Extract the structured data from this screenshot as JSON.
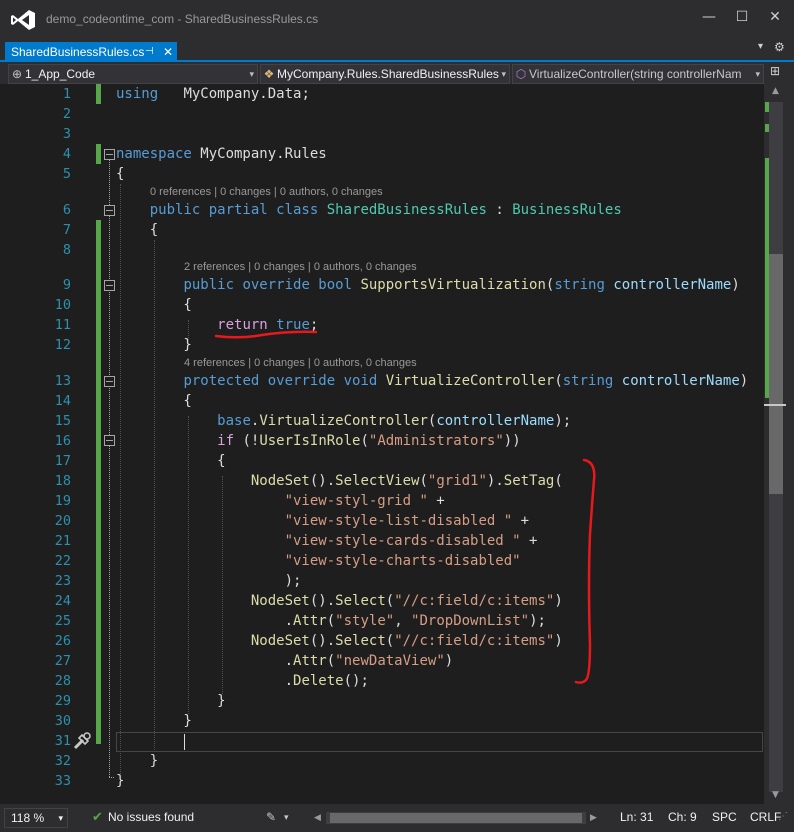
{
  "window": {
    "title": "demo_codeontime_com - SharedBusinessRules.cs",
    "controls": {
      "minimize": "—",
      "maximize": "☐",
      "close": "✕"
    }
  },
  "tabs": [
    {
      "label": "SharedBusinessRules.cs",
      "pin": "⊣",
      "close": "✕"
    }
  ],
  "tab_tools": {
    "dropdown": "▾",
    "settings": "⚙"
  },
  "navbar": {
    "project": "1_App_Code",
    "type": "MyCompany.Rules.SharedBusinessRules",
    "member": "VirtualizeController(string controllerNam",
    "icons": {
      "project": "globe-icon",
      "type": "class-icon",
      "member": "method-icon"
    }
  },
  "editor": {
    "lens": [
      "0 references | 0 changes | 0 authors, 0 changes",
      "2 references | 0 changes | 0 authors, 0 changes",
      "4 references | 0 changes | 0 authors, 0 changes"
    ],
    "lines": [
      {
        "n": "1",
        "tokens": [
          [
            "kw",
            "using"
          ],
          [
            "",
            "   MyCompany.Data;"
          ]
        ]
      },
      {
        "n": "2",
        "tokens": []
      },
      {
        "n": "3",
        "tokens": []
      },
      {
        "n": "4",
        "tokens": [
          [
            "kw",
            "namespace"
          ],
          [
            "",
            " MyCompany.Rules"
          ]
        ]
      },
      {
        "n": "5",
        "tokens": [
          [
            "",
            "{"
          ]
        ]
      },
      {
        "n": "6",
        "tokens": [
          [
            "",
            "    "
          ],
          [
            "kw",
            "public partial class "
          ],
          [
            "ty",
            "SharedBusinessRules"
          ],
          [
            "",
            " : "
          ],
          [
            "ty",
            "BusinessRules"
          ]
        ]
      },
      {
        "n": "7",
        "tokens": [
          [
            "",
            "    {"
          ]
        ]
      },
      {
        "n": "8",
        "tokens": []
      },
      {
        "n": "9",
        "tokens": [
          [
            "",
            "        "
          ],
          [
            "kw",
            "public override bool "
          ],
          [
            "mt",
            "SupportsVirtualization"
          ],
          [
            "",
            "("
          ],
          [
            "kw",
            "string "
          ],
          [
            "id",
            "controllerName"
          ],
          [
            "",
            ")"
          ]
        ]
      },
      {
        "n": "10",
        "tokens": [
          [
            "",
            "        {"
          ]
        ]
      },
      {
        "n": "11",
        "tokens": [
          [
            "",
            "            "
          ],
          [
            "ctrl",
            "return "
          ],
          [
            "kw",
            "true"
          ],
          [
            "",
            ";"
          ]
        ]
      },
      {
        "n": "12",
        "tokens": [
          [
            "",
            "        }"
          ]
        ]
      },
      {
        "n": "13",
        "tokens": [
          [
            "",
            "        "
          ],
          [
            "kw",
            "protected override void "
          ],
          [
            "mt",
            "VirtualizeController"
          ],
          [
            "",
            "("
          ],
          [
            "kw",
            "string "
          ],
          [
            "id",
            "controllerName"
          ],
          [
            "",
            ")"
          ]
        ]
      },
      {
        "n": "14",
        "tokens": [
          [
            "",
            "        {"
          ]
        ]
      },
      {
        "n": "15",
        "tokens": [
          [
            "",
            "            "
          ],
          [
            "kw",
            "base"
          ],
          [
            "",
            "."
          ],
          [
            "mt",
            "VirtualizeController"
          ],
          [
            "",
            "("
          ],
          [
            "id",
            "controllerName"
          ],
          [
            "",
            ");"
          ]
        ]
      },
      {
        "n": "16",
        "tokens": [
          [
            "",
            "            "
          ],
          [
            "ctrl",
            "if"
          ],
          [
            "",
            " (!"
          ],
          [
            "mt",
            "UserIsInRole"
          ],
          [
            "",
            "("
          ],
          [
            "str",
            "\"Administrators\""
          ],
          [
            "",
            "))"
          ]
        ]
      },
      {
        "n": "17",
        "tokens": [
          [
            "",
            "            {"
          ]
        ]
      },
      {
        "n": "18",
        "tokens": [
          [
            "",
            "                "
          ],
          [
            "mt",
            "NodeSet"
          ],
          [
            "",
            "()."
          ],
          [
            "mt",
            "SelectView"
          ],
          [
            "",
            "("
          ],
          [
            "str",
            "\"grid1\""
          ],
          [
            "",
            ")."
          ],
          [
            "mt",
            "SetTag"
          ],
          [
            "",
            "("
          ]
        ]
      },
      {
        "n": "19",
        "tokens": [
          [
            "",
            "                    "
          ],
          [
            "str",
            "\"view-styl-grid \""
          ],
          [
            "",
            " +"
          ]
        ]
      },
      {
        "n": "20",
        "tokens": [
          [
            "",
            "                    "
          ],
          [
            "str",
            "\"view-style-list-disabled \""
          ],
          [
            "",
            " +"
          ]
        ]
      },
      {
        "n": "21",
        "tokens": [
          [
            "",
            "                    "
          ],
          [
            "str",
            "\"view-style-cards-disabled \""
          ],
          [
            "",
            " +"
          ]
        ]
      },
      {
        "n": "22",
        "tokens": [
          [
            "",
            "                    "
          ],
          [
            "str",
            "\"view-style-charts-disabled\""
          ]
        ]
      },
      {
        "n": "23",
        "tokens": [
          [
            "",
            "                    );"
          ]
        ]
      },
      {
        "n": "24",
        "tokens": [
          [
            "",
            "                "
          ],
          [
            "mt",
            "NodeSet"
          ],
          [
            "",
            "()."
          ],
          [
            "mt",
            "Select"
          ],
          [
            "",
            "("
          ],
          [
            "str",
            "\"//c:field/c:items\""
          ],
          [
            "",
            ")"
          ]
        ]
      },
      {
        "n": "25",
        "tokens": [
          [
            "",
            "                    ."
          ],
          [
            "mt",
            "Attr"
          ],
          [
            "",
            "("
          ],
          [
            "str",
            "\"style\""
          ],
          [
            "",
            ", "
          ],
          [
            "str",
            "\"DropDownList\""
          ],
          [
            "",
            ");"
          ]
        ]
      },
      {
        "n": "26",
        "tokens": [
          [
            "",
            "                "
          ],
          [
            "mt",
            "NodeSet"
          ],
          [
            "",
            "()."
          ],
          [
            "mt",
            "Select"
          ],
          [
            "",
            "("
          ],
          [
            "str",
            "\"//c:field/c:items\""
          ],
          [
            "",
            ")"
          ]
        ]
      },
      {
        "n": "27",
        "tokens": [
          [
            "",
            "                    ."
          ],
          [
            "mt",
            "Attr"
          ],
          [
            "",
            "("
          ],
          [
            "str",
            "\"newDataView\""
          ],
          [
            "",
            ")"
          ]
        ]
      },
      {
        "n": "28",
        "tokens": [
          [
            "",
            "                    ."
          ],
          [
            "mt",
            "Delete"
          ],
          [
            "",
            "();"
          ]
        ]
      },
      {
        "n": "29",
        "tokens": [
          [
            "",
            "            }"
          ]
        ]
      },
      {
        "n": "30",
        "tokens": [
          [
            "",
            "        }"
          ]
        ]
      },
      {
        "n": "31",
        "tokens": []
      },
      {
        "n": "32",
        "tokens": [
          [
            "",
            "    }"
          ]
        ]
      },
      {
        "n": "33",
        "tokens": [
          [
            "",
            "}"
          ]
        ]
      }
    ],
    "annotation_color": "#e8191d"
  },
  "statusbar": {
    "zoom": "118 %",
    "issues": "No issues found",
    "brush_icon": "cleanup-brush-icon",
    "line": "Ln: 31",
    "col": "Ch: 9",
    "spc": "SPC",
    "eol": "CRLF"
  },
  "colors": {
    "accent": "#007acc",
    "editor_bg": "#1e1e1e",
    "keyword": "#569cd6",
    "type": "#4ec9b0",
    "string": "#d69d85",
    "method": "#dcdcaa",
    "parameter": "#9cdcfe",
    "control": "#d8a0df",
    "line_number": "#2b91af",
    "change_bar": "#57a64a"
  }
}
